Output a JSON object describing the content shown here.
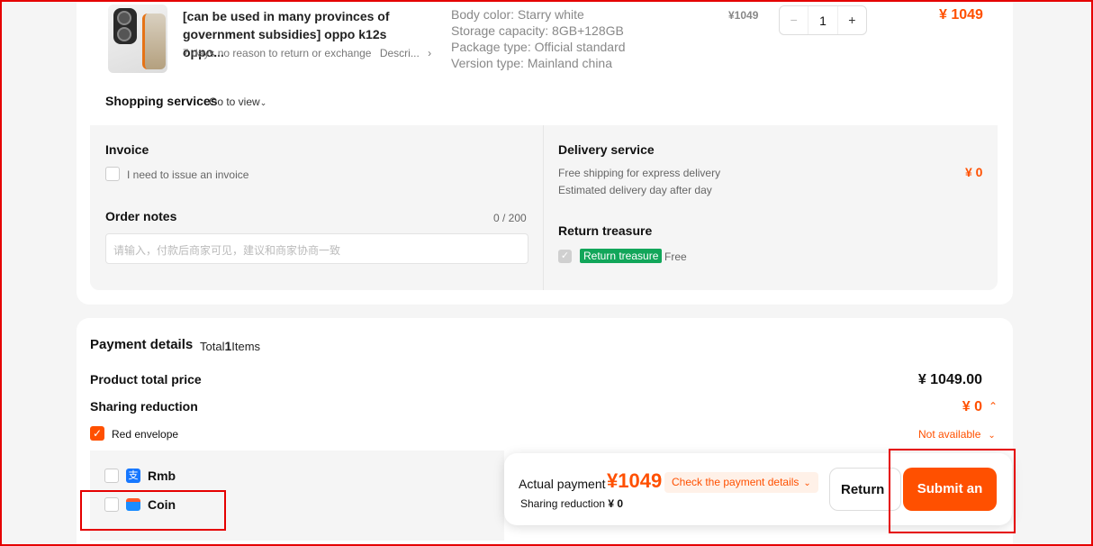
{
  "product": {
    "title": "[can be used in many provinces of government subsidies] oppo k12s oppo...",
    "policy": "7 days no reason to return or exchange",
    "desc_short": "Descri...",
    "specs": [
      "Body color: Starry white",
      "Storage capacity: 8GB+128GB",
      "Package type: Official standard",
      "Version type: Mainland china"
    ],
    "unit_price": "¥1049",
    "quantity": "1",
    "line_total": "¥ 1049"
  },
  "shopping_services": {
    "label": "Shopping services",
    "link": "Go to view"
  },
  "invoice": {
    "title": "Invoice",
    "checkbox_label": "I need to issue an invoice"
  },
  "order_notes": {
    "title": "Order notes",
    "counter": "0 / 200",
    "placeholder": "请输入，付款后商家可见，建议和商家协商一致"
  },
  "delivery": {
    "title": "Delivery service",
    "line1": "Free shipping for express delivery",
    "line2": "Estimated delivery day after day",
    "price": "¥ 0"
  },
  "return_treasure": {
    "title": "Return treasure",
    "badge": "Return treasure",
    "note": "Free"
  },
  "payment": {
    "title": "Payment details",
    "total_prefix": "Total",
    "total_count": "1",
    "total_suffix": "Items",
    "product_total_label": "Product total price",
    "product_total_value": "¥ 1049.00",
    "sharing_label": "Sharing reduction",
    "sharing_value": "¥ 0",
    "red_envelope_label": "Red envelope",
    "not_available": "Not available",
    "methods": [
      "Rmb",
      "Coin"
    ]
  },
  "bottom_bar": {
    "actual_label": "Actual payment",
    "actual_amount": "¥1049",
    "check_details": "Check the payment details",
    "sharing_line_label": "Sharing reduction",
    "sharing_line_value": "¥ 0",
    "return_label": "Return",
    "submit_label": "Submit an"
  },
  "colors": {
    "accent": "#ff5000",
    "badge_green": "#12a65a",
    "highlight": "#e50000"
  }
}
